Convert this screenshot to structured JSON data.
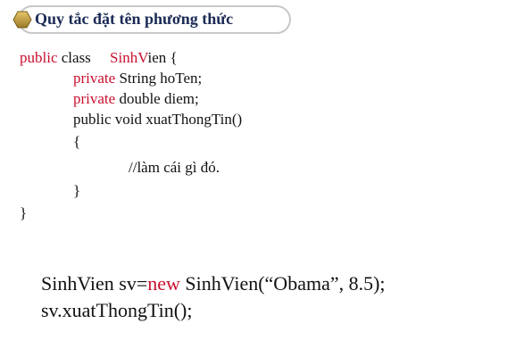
{
  "slide": {
    "title": "Quy tắc đặt tên phương thức",
    "accent_color": "#c8102e",
    "icon": "hexagon-bullet-icon"
  },
  "code": {
    "class_line": {
      "kw_public": "public",
      "class_word": " class     ",
      "name_a": "Sinh",
      "name_v": "V",
      "name_b": "ien {"
    },
    "field1": {
      "kw": "private",
      "rest": " String hoTen;"
    },
    "field2": {
      "kw": "private",
      "rest": " double diem;"
    },
    "method_sig": "public void xuatThongTin()",
    "open_brace": "{",
    "comment": "//làm cái gì đó.",
    "close_inner": "}",
    "close_outer": "}"
  },
  "usage": {
    "line1_pre": "SinhVien sv=",
    "line1_kw": "new",
    "line1_post": " SinhVien(“Obama”, 8.5);",
    "line2": "sv.xuatThongTin();"
  }
}
